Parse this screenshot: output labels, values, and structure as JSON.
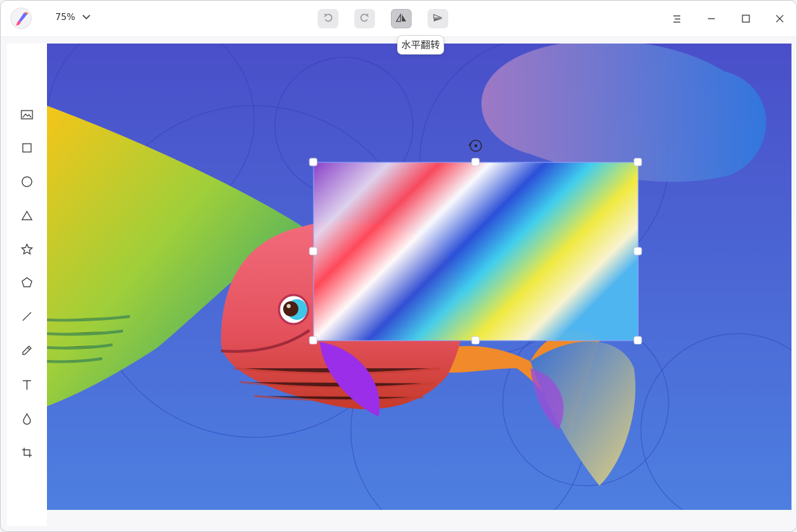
{
  "header": {
    "zoom_value": "75%",
    "flip_tooltip": "水平翻转"
  },
  "icons": {
    "app_logo": "paintbrush-logo-icon",
    "zoom_dropdown": "chevron-down-icon",
    "undo": "undo-icon",
    "redo": "redo-icon",
    "flip_horizontal": "flip-horizontal-icon",
    "flip_vertical": "flip-vertical-icon",
    "menu": "hamburger-menu-icon",
    "minimize": "minimize-icon",
    "maximize": "maximize-icon",
    "close": "close-icon"
  },
  "tools": [
    {
      "name": "image-tool",
      "icon": "image-icon"
    },
    {
      "name": "rectangle-tool",
      "icon": "rectangle-icon"
    },
    {
      "name": "ellipse-tool",
      "icon": "circle-icon"
    },
    {
      "name": "triangle-tool",
      "icon": "triangle-icon"
    },
    {
      "name": "star-tool",
      "icon": "star-icon"
    },
    {
      "name": "polygon-tool",
      "icon": "pentagon-icon"
    },
    {
      "name": "line-tool",
      "icon": "line-icon"
    },
    {
      "name": "pen-tool",
      "icon": "pencil-icon"
    },
    {
      "name": "text-tool",
      "icon": "text-icon"
    },
    {
      "name": "blur-tool",
      "icon": "droplet-icon"
    },
    {
      "name": "crop-tool",
      "icon": "crop-icon"
    }
  ],
  "colors": {
    "canvas_background": "#4a63d4",
    "selection_handle": "#ffffff"
  }
}
